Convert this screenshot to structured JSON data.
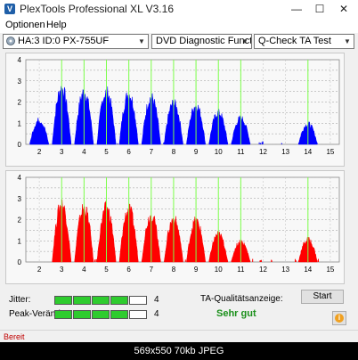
{
  "window": {
    "title": "PlexTools Professional XL V3.16",
    "icon_letter": "V",
    "minimize_glyph": "—",
    "maximize_glyph": "☐",
    "close_glyph": "✕"
  },
  "menu": {
    "items": [
      "Optionen",
      "Help"
    ]
  },
  "toolbar": {
    "drive": "HA:3 ID:0  PX-755UF",
    "test_mode": "DVD Diagnostic Functions",
    "test_type": "Q-Check TA Test",
    "arrow_glyph": "▼"
  },
  "colors": {
    "land": "#0000ff",
    "groove": "#ff0000",
    "marker": "#7cff4a",
    "plot_bg": "#f8f8f8",
    "quality_good": "#1a8f1a",
    "bar_fill": "#2ecc2e"
  },
  "chart_data": [
    {
      "type": "area",
      "series": [
        {
          "values": [
            0.4,
            0.9,
            0.6,
            0.5,
            0.5,
            0.6,
            0.6,
            0.5,
            0.6,
            0.4,
            0.4,
            0,
            0,
            0.5,
            0.2
          ]
        }
      ],
      "peaks": [
        3.0,
        2.8,
        2.8,
        2.7,
        2.5,
        2.2,
        2.1,
        1.7,
        1.4,
        1.1,
        1.3
      ],
      "peak_positions": [
        3,
        4,
        5,
        6,
        7,
        8,
        9,
        10,
        11,
        14,
        2
      ],
      "x_ticks": [
        "2",
        "3",
        "4",
        "5",
        "6",
        "7",
        "8",
        "9",
        "10",
        "11",
        "12",
        "13",
        "14",
        "15"
      ],
      "y_ticks": [
        "4",
        "3.5",
        "3",
        "2.5",
        "2",
        "1.5",
        "1",
        "0.5",
        "0"
      ],
      "xlim": [
        1.4,
        15.4
      ],
      "ylim": [
        0,
        4
      ],
      "markers": [
        3,
        4,
        5,
        6,
        7,
        8,
        9,
        10,
        11,
        14
      ],
      "color": "#0000ff"
    },
    {
      "type": "area",
      "peaks": [
        3.1,
        2.9,
        2.9,
        2.8,
        2.5,
        2.3,
        2.2,
        1.5,
        1.1,
        1.2
      ],
      "peak_positions": [
        3,
        4,
        5,
        6,
        7,
        8,
        9,
        10,
        11,
        14
      ],
      "x_ticks": [
        "2",
        "3",
        "4",
        "5",
        "6",
        "7",
        "8",
        "9",
        "10",
        "11",
        "12",
        "13",
        "14",
        "15"
      ],
      "y_ticks": [
        "4",
        "3.5",
        "3",
        "2.5",
        "2",
        "1.5",
        "1",
        "0.5",
        "0"
      ],
      "xlim": [
        1.4,
        15.4
      ],
      "ylim": [
        0,
        4
      ],
      "markers": [
        3,
        4,
        5,
        6,
        7,
        8,
        9,
        10,
        11,
        14
      ],
      "color": "#ff0000"
    }
  ],
  "quality": {
    "jitter_label": "Jitter:",
    "jitter_value": "4",
    "jitter_level": 4,
    "peak_label": "Peak-Veränd:",
    "peak_value": "4",
    "peak_level": 4,
    "segments_total": 5,
    "ta_label": "TA-Qualitätsanzeige:",
    "ta_value": "Sehr gut",
    "start_button": "Start",
    "info_glyph": "i"
  },
  "status": {
    "text": "Bereit"
  },
  "caption": {
    "text": "569x550  70kb  JPEG"
  }
}
